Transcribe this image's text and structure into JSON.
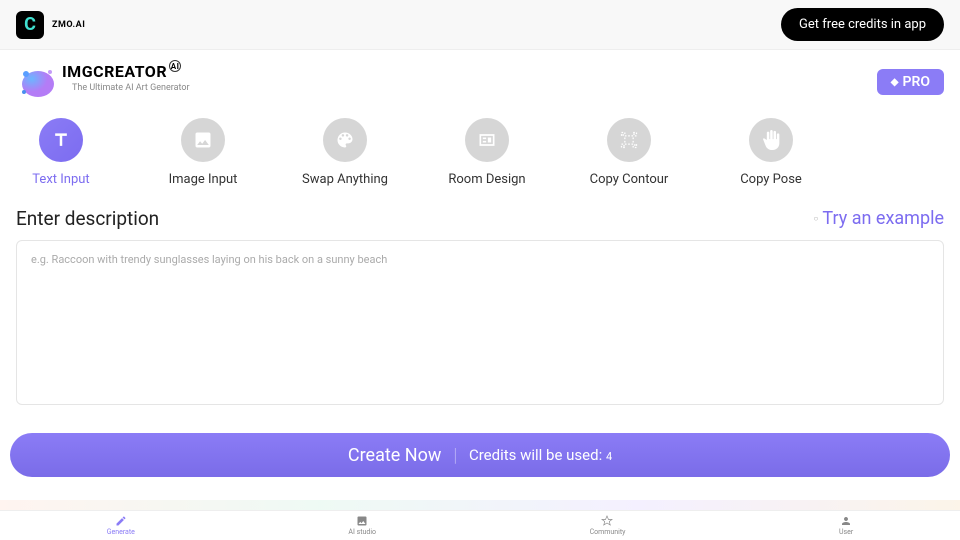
{
  "topbar": {
    "brand": "ZMO.AI",
    "credits_btn": "Get free credits in app"
  },
  "header": {
    "title": "IMGCREATOR",
    "ai": "AI",
    "subtitle": "The Ultimate AI Art Generator",
    "pro": "PRO"
  },
  "tabs": [
    {
      "label": "Text Input",
      "active": true
    },
    {
      "label": "Image Input",
      "active": false
    },
    {
      "label": "Swap Anything",
      "active": false
    },
    {
      "label": "Room Design",
      "active": false
    },
    {
      "label": "Copy Contour",
      "active": false
    },
    {
      "label": "Copy Pose",
      "active": false
    }
  ],
  "desc": {
    "title": "Enter description",
    "try": "Try an example",
    "placeholder": "e.g. Raccoon with trendy sunglasses laying on his back on a sunny beach"
  },
  "create": {
    "label": "Create Now",
    "credits_label": "Credits will be used:",
    "credits_num": "4"
  },
  "nav": [
    {
      "label": "Generate",
      "active": true
    },
    {
      "label": "AI studio",
      "active": false
    },
    {
      "label": "Community",
      "active": false
    },
    {
      "label": "User",
      "active": false
    }
  ]
}
